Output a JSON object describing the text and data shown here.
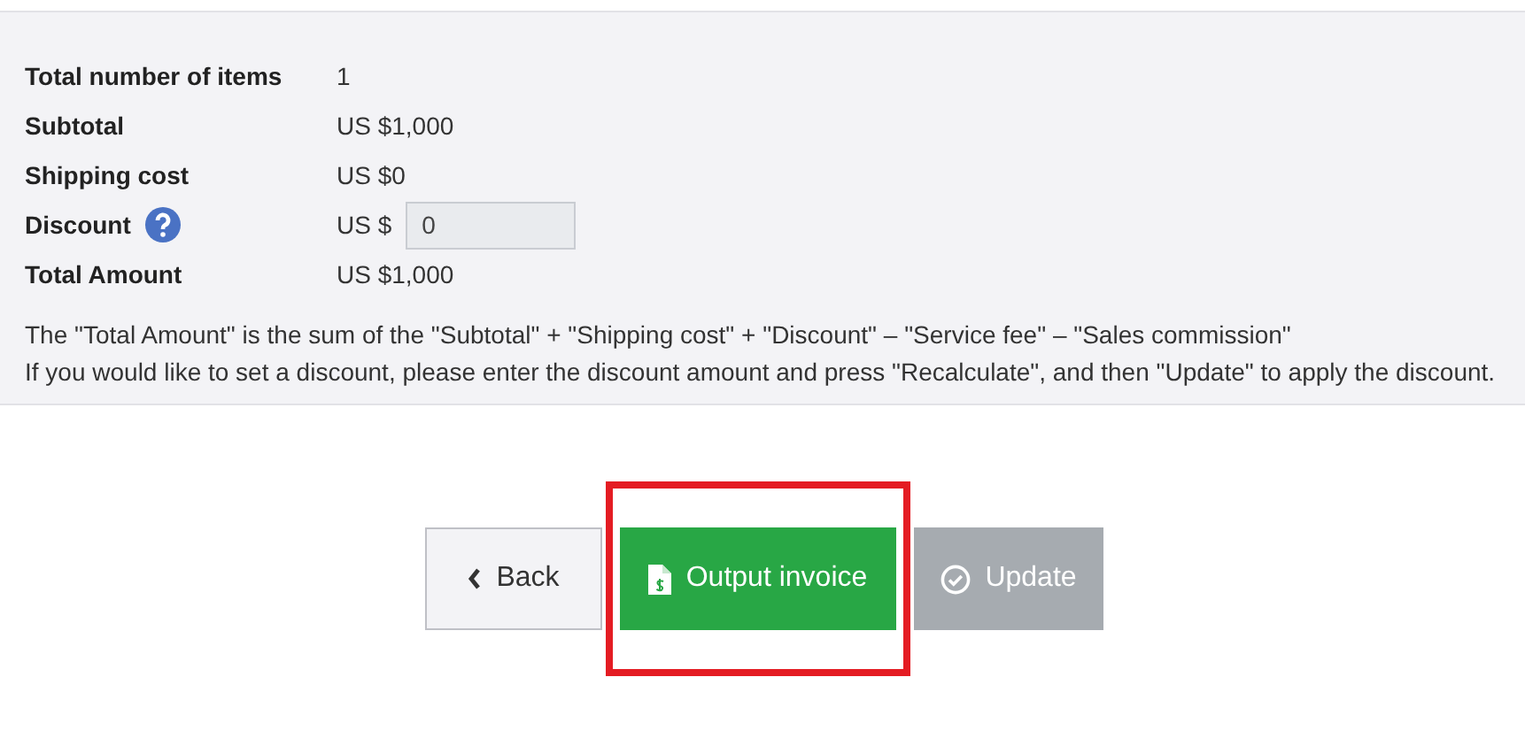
{
  "summary": {
    "rows": [
      {
        "kind": "text",
        "label": "Total number of items",
        "value": "1"
      },
      {
        "kind": "text",
        "label": "Subtotal",
        "value": "US $1,000"
      },
      {
        "kind": "text",
        "label": "Shipping cost",
        "value": "US $0"
      },
      {
        "kind": "input",
        "label": "Discount",
        "help": true,
        "prefix": "US $",
        "value": "0"
      },
      {
        "kind": "text",
        "label": "Total Amount",
        "value": "US $1,000"
      }
    ],
    "notes": [
      "The \"Total Amount\" is the sum of the \"Subtotal\" + \"Shipping cost\" + \"Discount\" – \"Service fee\" – \"Sales commission\"",
      "If you would like to set a discount, please enter the discount amount and press \"Recalculate\", and then \"Update\" to apply the discount."
    ]
  },
  "buttons": [
    {
      "kind": "back",
      "label": "Back",
      "disabled": false,
      "highlighted": false
    },
    {
      "kind": "invoice",
      "label": "Output invoice",
      "disabled": false,
      "highlighted": true
    },
    {
      "kind": "update",
      "label": "Update",
      "disabled": true,
      "highlighted": false
    }
  ]
}
